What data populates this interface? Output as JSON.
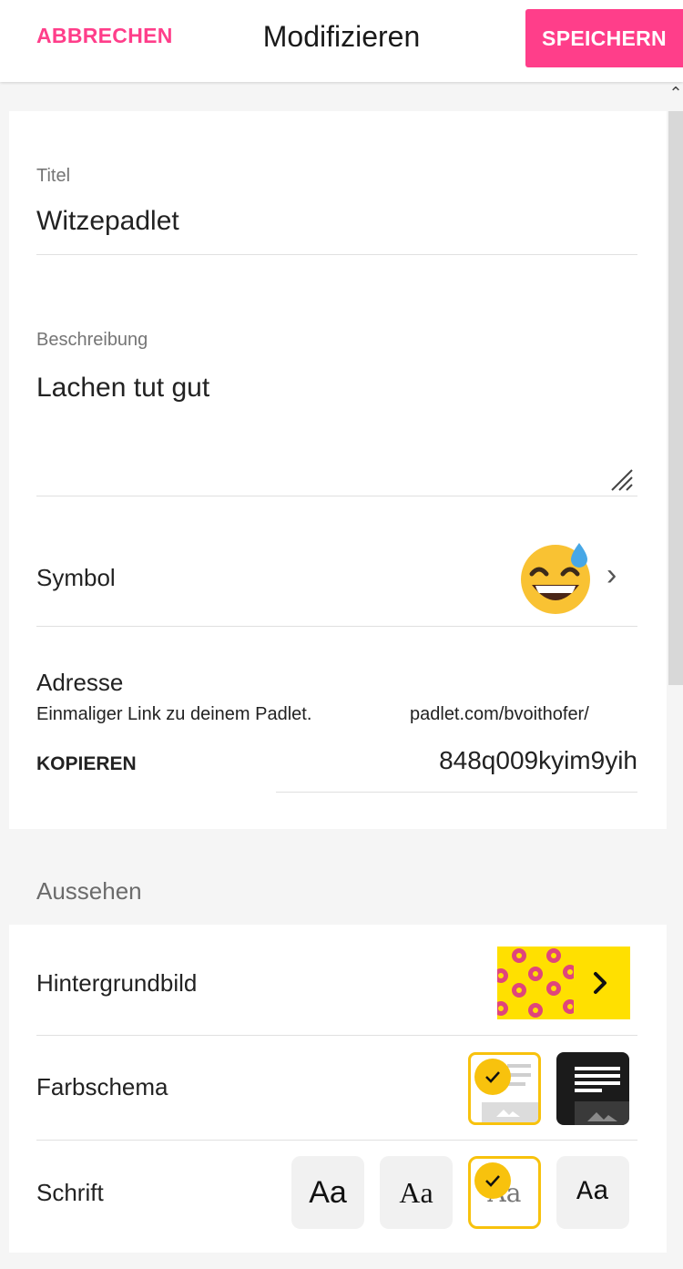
{
  "header": {
    "cancel_label": "ABBRECHEN",
    "title": "Modifizieren",
    "save_label": "SPEICHERN"
  },
  "form": {
    "title": {
      "label": "Titel",
      "value": "Witzepadlet"
    },
    "description": {
      "label": "Beschreibung",
      "value": "Lachen tut gut"
    },
    "symbol": {
      "label": "Symbol",
      "icon": "grinning-sweat-emoji-icon"
    },
    "address": {
      "label": "Adresse",
      "hint": "Einmaliger Link zu deinem Padlet.",
      "copy_label": "KOPIEREN",
      "url_prefix": "padlet.com/bvoithofer/",
      "url_slug": "848q009kyim9yih"
    }
  },
  "appearance": {
    "section_label": "Aussehen",
    "wallpaper_label": "Hintergrundbild",
    "color_scheme_label": "Farbschema",
    "font_label": "Schrift",
    "font_samples": [
      "Aa",
      "Aa",
      "Aa",
      "Aa"
    ],
    "selected_font_index": 2,
    "selected_scheme_index": 0
  },
  "colors": {
    "accent": "#ff3e8a",
    "check": "#f8c20d",
    "wallpaper": "#ffe000",
    "donut": "#e0457b"
  }
}
